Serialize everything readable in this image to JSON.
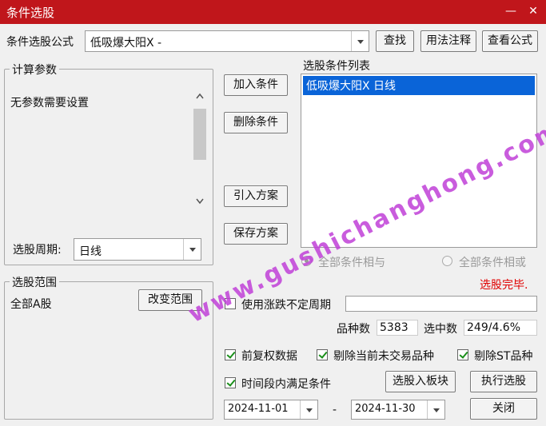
{
  "window": {
    "title": "条件选股",
    "minimize_glyph": "—",
    "close_glyph": "✕"
  },
  "formula": {
    "label": "条件选股公式",
    "value": "低吸爆大阳X  -",
    "find_label": "查找",
    "usage_label": "用法注释",
    "view_label": "查看公式"
  },
  "params": {
    "group_label": "计算参数",
    "text": "无参数需要设置",
    "period_label": "选股周期:",
    "period_value": "日线"
  },
  "actions": {
    "add_label": "加入条件",
    "delete_label": "删除条件",
    "import_label": "引入方案",
    "save_label": "保存方案"
  },
  "conditions": {
    "list_label": "选股条件列表",
    "items": [
      "低吸爆大阳X  日线"
    ],
    "radio_and_label": "全部条件相与",
    "radio_or_label": "全部条件相或",
    "status_text": "选股完毕."
  },
  "scope": {
    "group_label": "选股范围",
    "text": "全部A股",
    "change_label": "改变范围"
  },
  "options": {
    "volatile_period_label": "使用涨跌不定周期",
    "volatile_period_value": "",
    "count_label": "品种数",
    "count_value": "5383",
    "selected_label": "选中数",
    "selected_value": "249/4.6%",
    "fq_label": "前复权数据",
    "remove_untraded_label": "剔除当前未交易品种",
    "remove_st_label": "剔除ST品种",
    "period_cond_label": "时间段内满足条件",
    "to_block_label": "选股入板块",
    "execute_label": "执行选股",
    "close_label": "关闭",
    "date_from": "2024-11-01",
    "date_sep": "-",
    "date_to": "2024-11-30"
  },
  "watermark": {
    "text": "www.gushichanghong.com"
  },
  "colors": {
    "titlebar": "#c0161b",
    "selection": "#0a64d8",
    "status": "#e00000",
    "watermark": "#c040d8"
  },
  "icons": [
    "minimize-icon",
    "close-icon",
    "chevron-down-icon",
    "scroll-up-icon",
    "scroll-down-icon",
    "checkbox-icon",
    "radio-icon"
  ]
}
